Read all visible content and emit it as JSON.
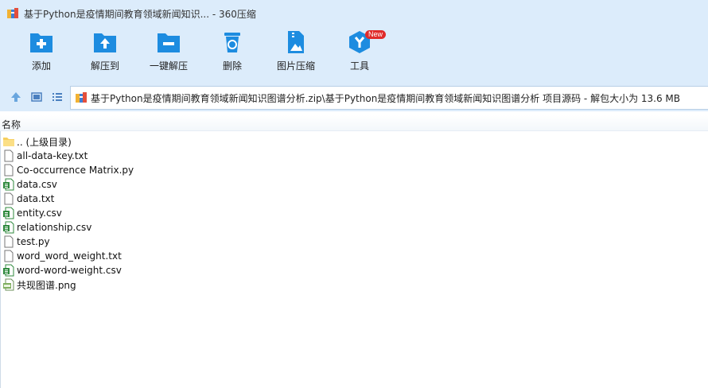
{
  "window": {
    "title": "基于Python是疫情期间教育领域新闻知识... - 360压缩"
  },
  "toolbar": {
    "buttons": [
      {
        "label": "添加",
        "icon": "add-icon"
      },
      {
        "label": "解压到",
        "icon": "extract-to-icon"
      },
      {
        "label": "一键解压",
        "icon": "one-click-extract-icon"
      },
      {
        "label": "删除",
        "icon": "delete-icon"
      },
      {
        "label": "图片压缩",
        "icon": "image-compress-icon"
      },
      {
        "label": "工具",
        "icon": "tools-icon",
        "badge": "New"
      }
    ]
  },
  "address": {
    "path": "基于Python是疫情期间教育领域新闻知识图谱分析.zip\\基于Python是疫情期间教育领域新闻知识图谱分析 项目源码 - 解包大小为 13.6 MB"
  },
  "list": {
    "column_name": "名称",
    "items": [
      {
        "name": ".. (上级目录)",
        "type": "folder"
      },
      {
        "name": "all-data-key.txt",
        "type": "txt"
      },
      {
        "name": "Co-occurrence Matrix.py",
        "type": "py"
      },
      {
        "name": "data.csv",
        "type": "csv"
      },
      {
        "name": "data.txt",
        "type": "txt"
      },
      {
        "name": "entity.csv",
        "type": "csv"
      },
      {
        "name": "relationship.csv",
        "type": "csv"
      },
      {
        "name": "test.py",
        "type": "py"
      },
      {
        "name": "word_word_weight.txt",
        "type": "txt"
      },
      {
        "name": "word-word-weight.csv",
        "type": "csv"
      },
      {
        "name": "共现图谱.png",
        "type": "png"
      }
    ]
  },
  "colors": {
    "chrome": "#dcecfb",
    "icon_blue": "#1d8ce0",
    "badge_red": "#e02b2b"
  }
}
